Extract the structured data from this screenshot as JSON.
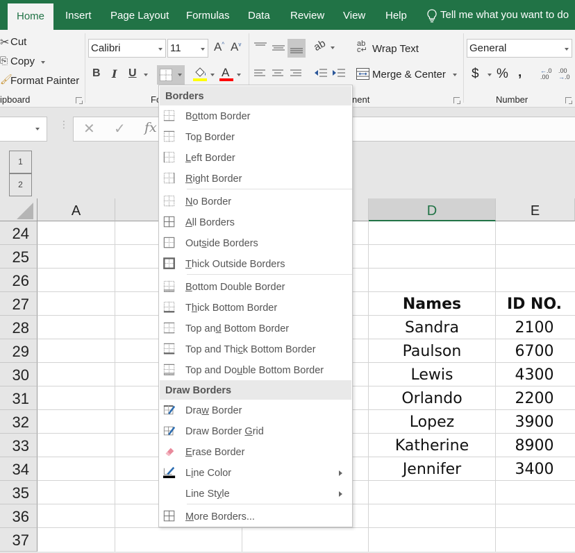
{
  "tabs": [
    {
      "label": "Home",
      "active": true
    },
    {
      "label": "Insert"
    },
    {
      "label": "Page Layout"
    },
    {
      "label": "Formulas"
    },
    {
      "label": "Data"
    },
    {
      "label": "Review"
    },
    {
      "label": "View"
    },
    {
      "label": "Help"
    }
  ],
  "tell_me": "Tell me what you want to do",
  "clipboard": {
    "cut": "Cut",
    "copy": "Copy",
    "format_painter": "Format Painter",
    "group_label": "ipboard"
  },
  "font": {
    "font_name": "Calibri",
    "font_size": "11",
    "bold": "B",
    "italic": "I",
    "underline": "U",
    "group_label": "Fo",
    "fill_color": "#ffff00",
    "font_color": "#ff0000"
  },
  "alignment": {
    "wrap_text": "Wrap Text",
    "merge_center": "Merge & Center",
    "group_label": "nent"
  },
  "number": {
    "format": "General",
    "currency": "$",
    "percent": "%",
    "comma": ",",
    "group_label": "Number"
  },
  "formula_bar": {
    "name_box": "",
    "formula": ""
  },
  "outline_levels": [
    "1",
    "2"
  ],
  "columns": [
    {
      "label": "A",
      "selected": false
    },
    {
      "label": "",
      "selected": false
    },
    {
      "label": "",
      "selected": false
    },
    {
      "label": "D",
      "selected": true
    },
    {
      "label": "E",
      "selected": false
    }
  ],
  "rows": [
    "24",
    "25",
    "26",
    "27",
    "28",
    "29",
    "30",
    "31",
    "32",
    "33",
    "34",
    "35",
    "36",
    "37"
  ],
  "table": {
    "headers": [
      "Names",
      "ID NO."
    ],
    "rows": [
      [
        "Sandra",
        "2100"
      ],
      [
        "Paulson",
        "6700"
      ],
      [
        "Lewis",
        "4300"
      ],
      [
        "Orlando",
        "2200"
      ],
      [
        "Lopez",
        "3900"
      ],
      [
        "Katherine",
        "8900"
      ],
      [
        "Jennifer",
        "3400"
      ]
    ]
  },
  "borders_menu": {
    "header_borders": "Borders",
    "header_draw": "Draw Borders",
    "items": [
      {
        "pre": "B",
        "u": "o",
        "post": "ttom Border",
        "icon": "bottom-border-icon"
      },
      {
        "pre": "To",
        "u": "p",
        "post": " Border",
        "icon": "top-border-icon"
      },
      {
        "pre": "",
        "u": "L",
        "post": "eft Border",
        "icon": "left-border-icon"
      },
      {
        "pre": "",
        "u": "R",
        "post": "ight Border",
        "icon": "right-border-icon"
      },
      {
        "pre": "",
        "u": "N",
        "post": "o Border",
        "icon": "no-border-icon"
      },
      {
        "pre": "",
        "u": "A",
        "post": "ll Borders",
        "icon": "all-borders-icon"
      },
      {
        "pre": "Out",
        "u": "s",
        "post": "ide Borders",
        "icon": "outside-borders-icon"
      },
      {
        "pre": "",
        "u": "T",
        "post": "hick Outside Borders",
        "icon": "thick-outside-borders-icon"
      },
      {
        "pre": "",
        "u": "B",
        "post": "ottom Double Border",
        "icon": "bottom-double-border-icon"
      },
      {
        "pre": "T",
        "u": "h",
        "post": "ick Bottom Border",
        "icon": "thick-bottom-border-icon"
      },
      {
        "pre": "Top an",
        "u": "d",
        "post": " Bottom Border",
        "icon": "top-bottom-border-icon"
      },
      {
        "pre": "Top and Thi",
        "u": "c",
        "post": "k Bottom Border",
        "icon": "top-thick-bottom-border-icon"
      },
      {
        "pre": "Top and Do",
        "u": "u",
        "post": "ble Bottom Border",
        "icon": "top-double-bottom-border-icon"
      }
    ],
    "draw_items": [
      {
        "pre": "Dra",
        "u": "w",
        "post": " Border",
        "icon": "draw-border-icon"
      },
      {
        "pre": "Draw Border ",
        "u": "G",
        "post": "rid",
        "icon": "draw-border-grid-icon"
      },
      {
        "pre": "",
        "u": "E",
        "post": "rase Border",
        "icon": "eraser-icon"
      },
      {
        "pre": "L",
        "u": "i",
        "post": "ne Color",
        "icon": "line-color-icon",
        "submenu": true
      },
      {
        "pre": "Line St",
        "u": "y",
        "post": "le",
        "icon": "",
        "submenu": true
      },
      {
        "pre": "",
        "u": "M",
        "post": "ore Borders...",
        "icon": "more-borders-icon"
      }
    ]
  }
}
